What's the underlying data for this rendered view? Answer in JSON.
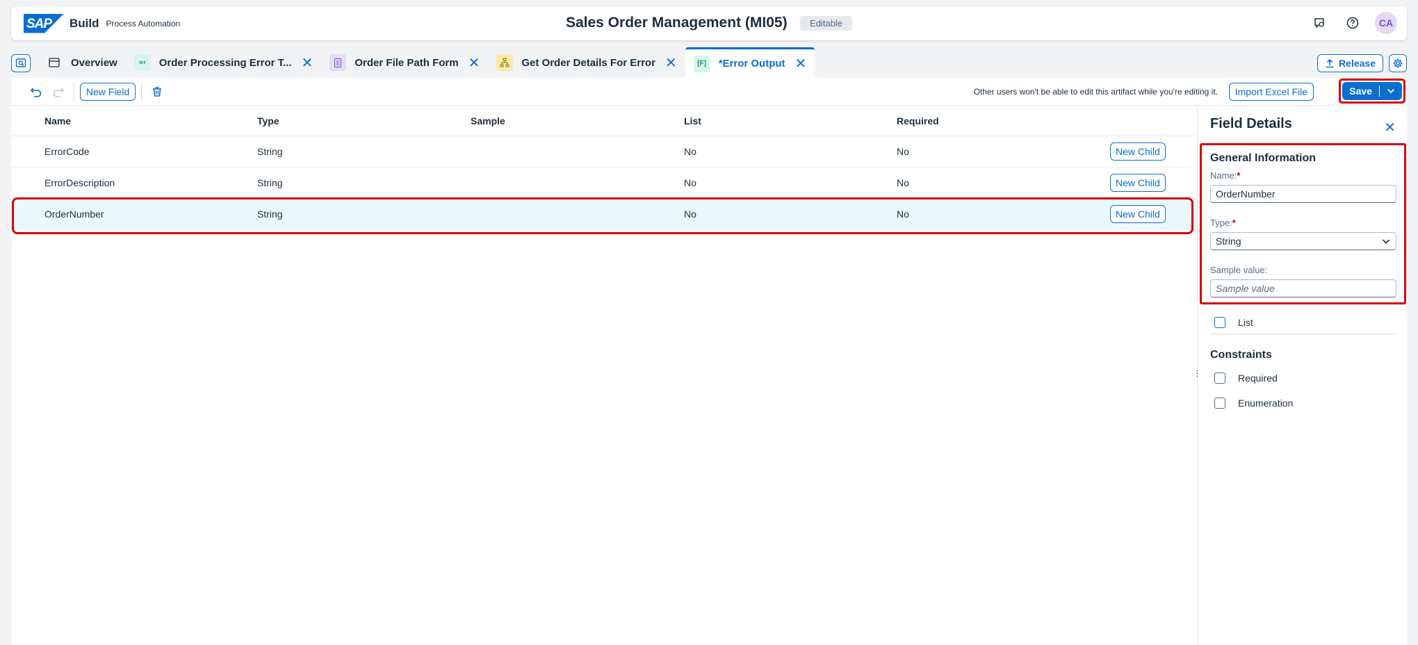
{
  "shell": {
    "logo": "SAP",
    "brand": "Build",
    "brand_sub": "Process Automation",
    "title": "Sales Order Management (MI05)",
    "status_badge": "Editable",
    "avatar": "CA"
  },
  "tabs": [
    {
      "label": "Overview",
      "icon": "file-icon"
    },
    {
      "label": "Order Processing Error T...",
      "icon": "process-icon"
    },
    {
      "label": "Order File Path Form",
      "icon": "form-icon"
    },
    {
      "label": "Get Order Details For Error",
      "icon": "decision-icon"
    },
    {
      "label": "*Error Output",
      "icon": "data-type-icon",
      "active": true
    }
  ],
  "tabbar": {
    "release": "Release"
  },
  "toolbar": {
    "new_field": "New Field",
    "note": "Other users won't be able to edit this artifact while you're editing it.",
    "import": "Import Excel File",
    "save": "Save"
  },
  "table": {
    "headers": {
      "name": "Name",
      "type": "Type",
      "sample": "Sample",
      "list": "List",
      "required": "Required"
    },
    "rows": [
      {
        "name": "ErrorCode",
        "type": "String",
        "sample": "",
        "list": "No",
        "required": "No",
        "action": "New Child"
      },
      {
        "name": "ErrorDescription",
        "type": "String",
        "sample": "",
        "list": "No",
        "required": "No",
        "action": "New Child"
      },
      {
        "name": "OrderNumber",
        "type": "String",
        "sample": "",
        "list": "No",
        "required": "No",
        "action": "New Child",
        "selected": true
      }
    ]
  },
  "details": {
    "title": "Field Details",
    "general_title": "General Information",
    "name_label": "Name:",
    "name_value": "OrderNumber",
    "type_label": "Type:",
    "type_value": "String",
    "sample_label": "Sample value:",
    "sample_placeholder": "Sample value",
    "list_label": "List",
    "constraints_title": "Constraints",
    "required_label": "Required",
    "enumeration_label": "Enumeration"
  },
  "colors": {
    "accent": "#0a6ed1",
    "highlight": "#d40000",
    "selected_row": "#ebf8ff"
  }
}
